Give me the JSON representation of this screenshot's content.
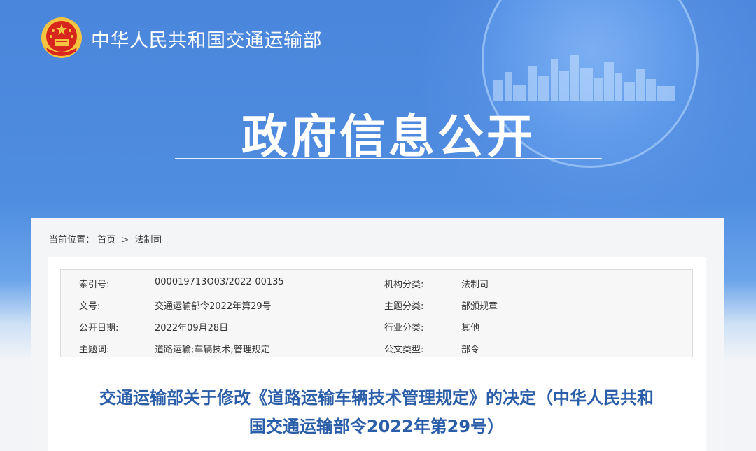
{
  "header": {
    "ministry_name": "中华人民共和国交通运输部",
    "hero_title": "政府信息公开"
  },
  "breadcrumb": {
    "label": "当前位置：",
    "home": "首页",
    "separator": ">",
    "current": "法制司"
  },
  "meta": {
    "rows": [
      {
        "k1": "索引号:",
        "v1": "000019713O03/2022-00135",
        "k2": "机构分类:",
        "v2": "法制司"
      },
      {
        "k1": "文号:",
        "v1": "交通运输部令2022年第29号",
        "k2": "主题分类:",
        "v2": "部颁规章"
      },
      {
        "k1": "公开日期:",
        "v1": "2022年09月28日",
        "k2": "行业分类:",
        "v2": "其他"
      },
      {
        "k1": "主题词:",
        "v1": "道路运输;车辆技术;管理规定",
        "k2": "公文类型:",
        "v2": "部令"
      }
    ]
  },
  "document": {
    "title_line1": "交通运输部关于修改《道路运输车辆技术管理规定》的决定（中华人民共和",
    "title_line2": "国交通运输部令2022年第29号）"
  },
  "colors": {
    "banner_blue": "#4a86db",
    "title_blue": "#2b5ea8",
    "emblem_red": "#d7261e",
    "emblem_gold": "#f5c542"
  },
  "icons": {
    "emblem": "national-emblem-icon",
    "skyline": "city-skyline-decoration"
  }
}
